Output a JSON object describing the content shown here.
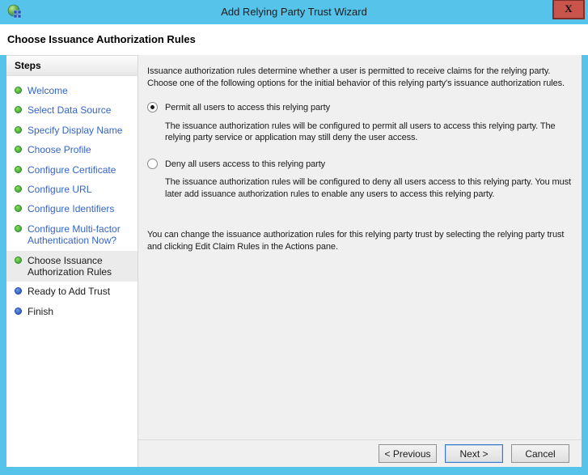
{
  "window": {
    "title": "Add Relying Party Trust Wizard",
    "close_glyph": "X"
  },
  "header": {
    "title": "Choose Issuance Authorization Rules"
  },
  "sidebar": {
    "title": "Steps",
    "items": [
      {
        "label": "Welcome",
        "state": "completed"
      },
      {
        "label": "Select Data Source",
        "state": "completed"
      },
      {
        "label": "Specify Display Name",
        "state": "completed"
      },
      {
        "label": "Choose Profile",
        "state": "completed"
      },
      {
        "label": "Configure Certificate",
        "state": "completed"
      },
      {
        "label": "Configure URL",
        "state": "completed"
      },
      {
        "label": "Configure Identifiers",
        "state": "completed"
      },
      {
        "label": "Configure Multi-factor Authentication Now?",
        "state": "completed"
      },
      {
        "label": "Choose Issuance Authorization Rules",
        "state": "current"
      },
      {
        "label": "Ready to Add Trust",
        "state": "upcoming"
      },
      {
        "label": "Finish",
        "state": "upcoming"
      }
    ]
  },
  "content": {
    "intro_lines": [
      "Issuance authorization rules determine whether a user is permitted to receive claims for the relying party.",
      "Choose one of the following options for the initial behavior of this relying party's issuance authorization rules."
    ],
    "options": [
      {
        "label": "Permit all users to access this relying party",
        "description": "The issuance authorization rules will be configured to permit all users to access this relying party. The relying party service or application may still deny the user access.",
        "selected": true
      },
      {
        "label": "Deny all users access to this relying party",
        "description": "The issuance authorization rules will be configured to deny all users access to this relying party. You must later add issuance authorization rules to enable any users to access this relying party.",
        "selected": false
      }
    ],
    "note": "You can change the issuance authorization rules for this relying party trust by selecting the relying party trust and clicking Edit Claim Rules in the Actions pane."
  },
  "footer": {
    "previous_label": "< Previous",
    "next_label": "Next >",
    "cancel_label": "Cancel"
  },
  "colors": {
    "titlebar": "#56c3ea",
    "close_button": "#c9544c",
    "step_link": "#3464c9",
    "bullet_completed": "#2f9e2f",
    "bullet_upcoming": "#1d4fb8"
  }
}
